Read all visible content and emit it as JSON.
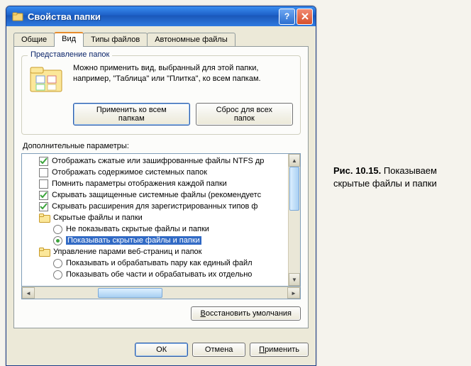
{
  "window": {
    "title": "Свойства папки"
  },
  "tabs": [
    "Общие",
    "Вид",
    "Типы файлов",
    "Автономные файлы"
  ],
  "active_tab_index": 1,
  "group": {
    "legend": "Представление папок",
    "desc": "Можно применить вид, выбранный для этой папки, например, \"Таблица\" или \"Плитка\", ко всем папкам.",
    "apply_btn": "Применить ко всем папкам",
    "reset_btn": "Сброс для всех папок"
  },
  "params_label": "Дополнительные параметры:",
  "tree": [
    {
      "type": "check",
      "checked": true,
      "indent": 0,
      "label": "Отображать сжатые или зашифрованные файлы NTFS др"
    },
    {
      "type": "check",
      "checked": false,
      "indent": 0,
      "label": "Отображать содержимое системных папок"
    },
    {
      "type": "check",
      "checked": false,
      "indent": 0,
      "label": "Помнить параметры отображения каждой папки"
    },
    {
      "type": "check",
      "checked": true,
      "indent": 0,
      "label": "Скрывать защищенные системные файлы (рекомендуетс"
    },
    {
      "type": "check",
      "checked": true,
      "indent": 0,
      "label": "Скрывать расширения для зарегистрированных типов ф"
    },
    {
      "type": "folder",
      "indent": 0,
      "label": "Скрытые файлы и папки"
    },
    {
      "type": "radio",
      "checked": false,
      "indent": 1,
      "label": "Не показывать скрытые файлы и папки"
    },
    {
      "type": "radio",
      "checked": true,
      "indent": 1,
      "label": "Показывать скрытые файлы и папки",
      "selected": true
    },
    {
      "type": "folder",
      "indent": 0,
      "label": "Управление парами веб-страниц и папок"
    },
    {
      "type": "radio",
      "checked": false,
      "indent": 1,
      "label": "Показывать и обрабатывать пару как единый файл"
    },
    {
      "type": "radio",
      "checked": false,
      "indent": 1,
      "label": "Показывать обе части и обрабатывать их отдельно"
    }
  ],
  "restore_btn": "Восстановить умолчания",
  "buttons": {
    "ok": "ОК",
    "cancel": "Отмена",
    "apply": "Применить"
  },
  "caption": {
    "prefix": "Рис. 10.15.",
    "text": " Показываем скрытые файлы и папки"
  },
  "accent": "#316ac5"
}
